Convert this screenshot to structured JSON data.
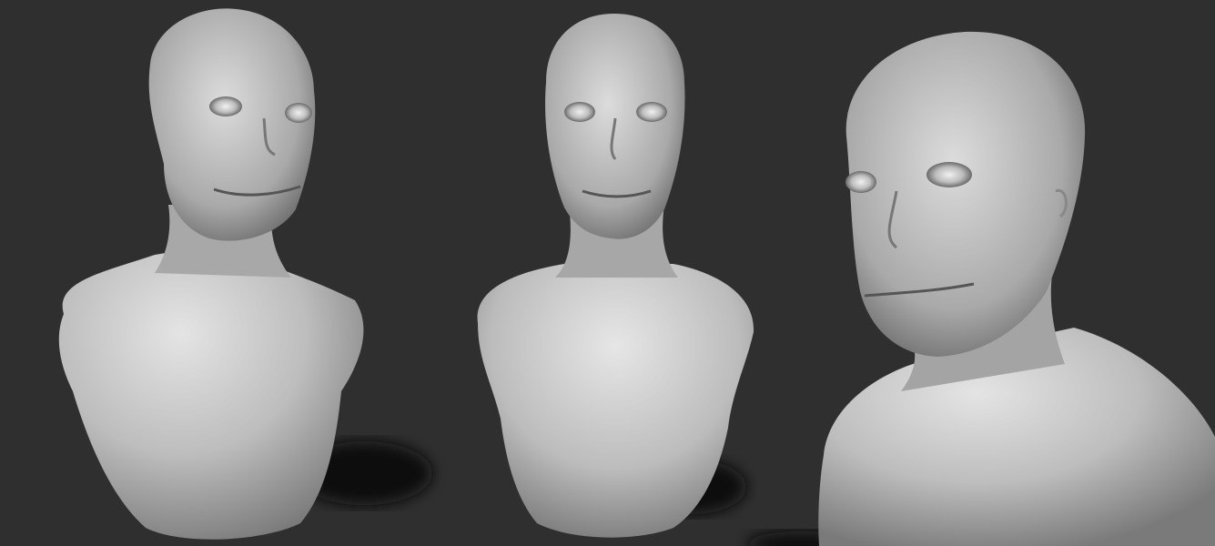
{
  "scene": {
    "background_color": "#2f2f2f",
    "material_color": "#c9c9c9",
    "shadow_color": "#111111",
    "views": [
      {
        "id": "view-three-quarter-left"
      },
      {
        "id": "view-front"
      },
      {
        "id": "view-three-quarter-close"
      }
    ]
  }
}
